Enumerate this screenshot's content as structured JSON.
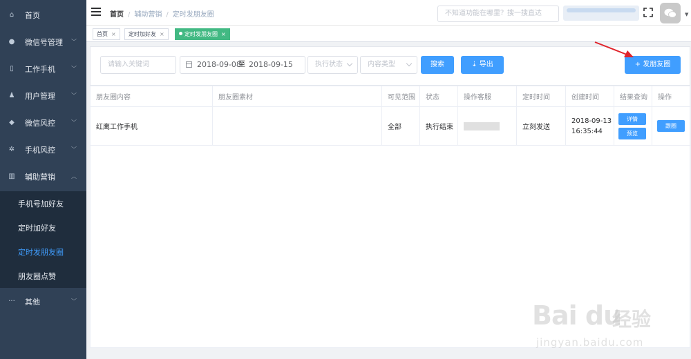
{
  "sidebar": {
    "items": [
      {
        "label": "首页",
        "icon": "home-icon",
        "glyph": "⌂"
      },
      {
        "label": "微信号管理",
        "icon": "wechat-icon",
        "glyph": "●"
      },
      {
        "label": "工作手机",
        "icon": "phone-icon",
        "glyph": "▯"
      },
      {
        "label": "用户管理",
        "icon": "user-icon",
        "glyph": "♟"
      },
      {
        "label": "微信风控",
        "icon": "shield-icon",
        "glyph": "◆"
      },
      {
        "label": "手机风控",
        "icon": "fan-icon",
        "glyph": "✲"
      },
      {
        "label": "辅助营销",
        "icon": "chart-icon",
        "glyph": "▥"
      }
    ],
    "submenu": [
      {
        "label": "手机号加好友"
      },
      {
        "label": "定时加好友"
      },
      {
        "label": "定时发朋友圈"
      },
      {
        "label": "朋友圈点赞"
      }
    ],
    "other": {
      "label": "其他",
      "icon": "more-icon",
      "glyph": "···"
    }
  },
  "navbar": {
    "breadcrumb": [
      "首页",
      "辅助营销",
      "定时发朋友圈"
    ],
    "search_placeholder": "不知道功能在哪里？搜一搜直达"
  },
  "tags": [
    {
      "label": "首页",
      "close": "×"
    },
    {
      "label": "定时加好友",
      "close": "×"
    },
    {
      "label": "定时发朋友圈",
      "close": "×"
    }
  ],
  "filters": {
    "keyword_placeholder": "请输入关键词",
    "date_start": "2018-09-08",
    "date_sep": "至",
    "date_end": "2018-09-15",
    "status_placeholder": "执行状态",
    "type_placeholder": "内容类型",
    "search_label": "搜索",
    "export_label": "⇣ 导出",
    "publish_label": "+ 发朋友圈"
  },
  "table": {
    "headers": [
      "朋友圈内容",
      "朋友圈素材",
      "可见范围",
      "状态",
      "操作客服",
      "定时时间",
      "创建时间",
      "结果查询",
      "操作"
    ],
    "rows": [
      {
        "content": "红鹰工作手机",
        "material": "",
        "scope": "全部",
        "status": "执行结束",
        "schedule": "立刻发送",
        "created_date": "2018-09-13",
        "created_time": "16:35:44",
        "detail_label": "详情",
        "preview_label": "预览",
        "follow_label": "跟圈"
      }
    ]
  },
  "watermark": {
    "logo": "Bai du",
    "cn": "经验",
    "url": "jingyan.baidu.com"
  },
  "colors": {
    "sidebar_bg": "#304156",
    "submenu_bg": "#1f2d3d",
    "accent": "#409eff",
    "tag_active": "#42b983",
    "annotation": "#e0242b"
  }
}
